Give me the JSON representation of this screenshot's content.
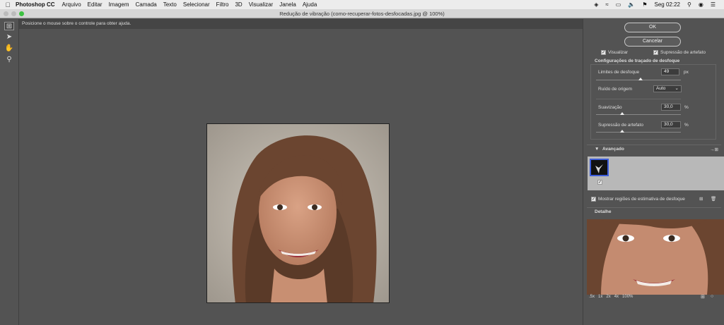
{
  "menubar": {
    "app_name": "Photoshop CC",
    "items": [
      "Arquivo",
      "Editar",
      "Imagem",
      "Camada",
      "Texto",
      "Selecionar",
      "Filtro",
      "3D",
      "Visualizar",
      "Janela",
      "Ajuda"
    ],
    "clock": "Seg 02:22"
  },
  "window": {
    "title": "Redução de vibração (como-recuperar-fotos-desfocadas.jpg @ 100%)"
  },
  "helpbar": {
    "text": "Posicione o mouse sobre o controle para obter ajuda."
  },
  "panel": {
    "ok_label": "OK",
    "cancel_label": "Cancelar",
    "preview_label": "Visualizar",
    "artifact_suppression_label": "Supressão de artefato",
    "trace_settings_title": "Configurações de traçado de desfoque",
    "blur_limit_label": "Limites de desfoque",
    "blur_limit_value": "49",
    "blur_limit_unit": "px",
    "source_noise_label": "Ruído de origem",
    "source_noise_value": "Auto",
    "smoothing_label": "Suavização",
    "smoothing_value": "30,0",
    "smoothing_unit": "%",
    "artifact_label": "Supressão de artefato",
    "artifact_value": "30,0",
    "artifact_unit": "%",
    "advanced_title": "Avançado",
    "show_regions_label": "Mostrar regiões de estimativa de desfoque",
    "detail_title": "Detalhe",
    "zoom_levels": [
      ".5x",
      "1x",
      "2x",
      "4x",
      "100%"
    ]
  },
  "colors": {
    "background": "#535353",
    "accent_border": "#3d5dd9"
  }
}
